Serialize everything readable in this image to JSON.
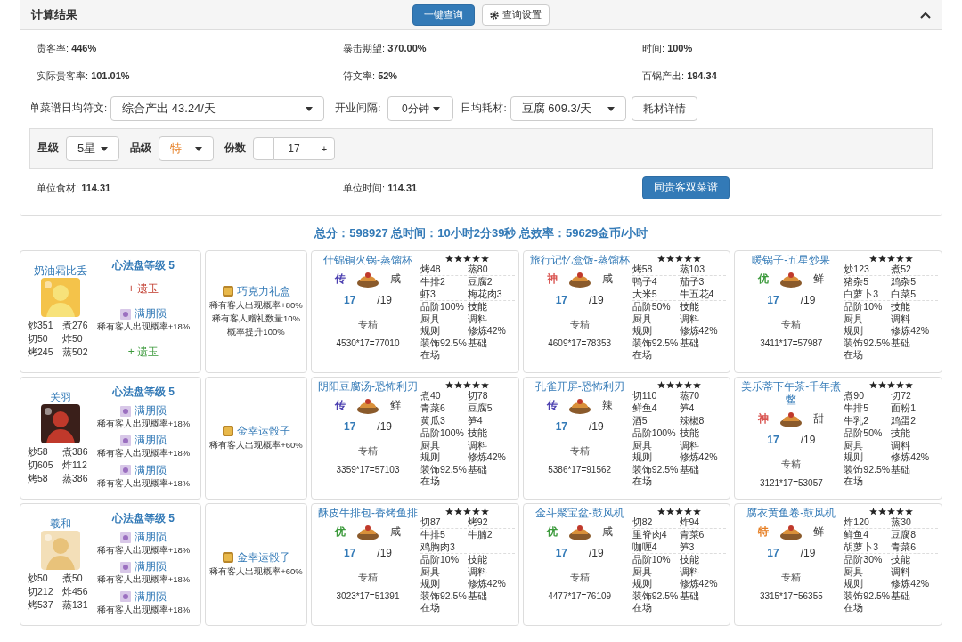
{
  "panel": {
    "title": "计算结果",
    "query_button": "一键查询",
    "settings_button": "查询设置",
    "stats": [
      "贵客率: **446%**",
      "暴击期望: **370.00%**",
      "时间: **100%**",
      "实际贵客率: **101.01%**",
      "符文率: **52%**",
      "百锅产出: **194.34**"
    ],
    "rune": {
      "label": "单菜谱日均符文:",
      "value": "综合产出 43.24/天"
    },
    "interval": {
      "label": "开业间隔:",
      "value": "0分钟"
    },
    "consume": {
      "label": "日均耗材:",
      "value": "豆腐 609.3/天"
    },
    "detail_button": "耗材详情",
    "filter": {
      "star_label": "星级",
      "star_value": "5星",
      "grade_label": "品级",
      "grade_value": "特",
      "count_label": "份数",
      "minus": "-",
      "count": "17",
      "plus": "+"
    },
    "units": [
      "单位食材: **114.31**",
      "单位时间: **114.31**"
    ],
    "dual_button": "同贵客双菜谱"
  },
  "total": "总分：598927 总时间：10小时2分39秒 总效率：59629金币/小时",
  "rows": [
    {
      "chef": {
        "name": "奶油霜比丢",
        "stats": [
          "炒351",
          "煮276",
          "切50",
          "炸50",
          "烤245",
          "蒸502"
        ],
        "panel_title": "心法盘等级 5",
        "items": [
          {
            "kind": "plus",
            "text": "+ 遗玉",
            "color": "#c0392b"
          },
          {
            "kind": "amber",
            "name": "满朋陨",
            "desc": "稀有客人出现概率+18%"
          },
          {
            "kind": "plus",
            "text": "+ 遗玉",
            "color": "#3c9a3c"
          }
        ]
      },
      "equip": {
        "name": "巧克力礼盒",
        "desc": [
          "稀有客人出现概率+80%",
          "稀有客人赠礼数量10%概率提升100%"
        ]
      },
      "recipes": [
        {
          "name": "什锦铜火锅-蒸馏杯",
          "rarity": "传",
          "color": "#4b3fb0",
          "taste": "咸",
          "count": "17",
          "max": "/19",
          "note": "专精",
          "formula": "4530*17=77010",
          "stars": 5,
          "skills": [
            "烤48",
            "蒸80"
          ],
          "ingredients": [
            "牛排2",
            "豆腐2",
            "虾3",
            "梅花肉3"
          ],
          "bonuses": [
            "品阶100%",
            "技能",
            "厨具",
            "调料",
            "规则",
            "修炼42%",
            "装饰92.5%",
            "基础",
            "在场"
          ]
        },
        {
          "name": "旅行记忆盒饭-蒸馏杯",
          "rarity": "神",
          "color": "#d9534f",
          "taste": "咸",
          "count": "17",
          "max": "/19",
          "note": "专精",
          "formula": "4609*17=78353",
          "stars": 5,
          "skills": [
            "烤58",
            "蒸103"
          ],
          "ingredients": [
            "鸭子4",
            "茄子3",
            "大米5",
            "牛五花4"
          ],
          "bonuses": [
            "品阶50%",
            "技能",
            "厨具",
            "调料",
            "规则",
            "修炼42%",
            "装饰92.5%",
            "基础",
            "在场"
          ]
        },
        {
          "name": "暖锅子-五星炒果",
          "rarity": "优",
          "color": "#3c9a3c",
          "taste": "鲜",
          "count": "17",
          "max": "/19",
          "note": "专精",
          "formula": "3411*17=57987",
          "stars": 5,
          "skills": [
            "炒123",
            "煮52"
          ],
          "ingredients": [
            "猪杂5",
            "鸡杂5",
            "白萝卜3",
            "白菜5"
          ],
          "bonuses": [
            "品阶10%",
            "技能",
            "厨具",
            "调料",
            "规则",
            "修炼42%",
            "装饰92.5%",
            "基础",
            "在场"
          ]
        }
      ]
    },
    {
      "chef": {
        "name": "关羽",
        "stats": [
          "炒58",
          "煮386",
          "切605",
          "炸112",
          "烤58",
          "蒸386"
        ],
        "panel_title": "心法盘等级 5",
        "items": [
          {
            "kind": "amber",
            "name": "满朋陨",
            "desc": "稀有客人出现概率+18%"
          },
          {
            "kind": "amber",
            "name": "满朋陨",
            "desc": "稀有客人出现概率+18%"
          },
          {
            "kind": "amber",
            "name": "满朋陨",
            "desc": "稀有客人出现概率+18%"
          }
        ]
      },
      "equip": {
        "name": "金幸运骰子",
        "desc": [
          "稀有客人出现概率+60%"
        ]
      },
      "recipes": [
        {
          "name": "阴阳豆腐汤-恐怖利刃",
          "rarity": "传",
          "color": "#4b3fb0",
          "taste": "鲜",
          "count": "17",
          "max": "/19",
          "note": "专精",
          "formula": "3359*17=57103",
          "stars": 5,
          "skills": [
            "煮40",
            "切78"
          ],
          "ingredients": [
            "青菜6",
            "豆腐5",
            "黄瓜3",
            "笋4"
          ],
          "bonuses": [
            "品阶100%",
            "技能",
            "厨具",
            "调料",
            "规则",
            "修炼42%",
            "装饰92.5%",
            "基础",
            "在场"
          ]
        },
        {
          "name": "孔雀开屏-恐怖利刃",
          "rarity": "传",
          "color": "#4b3fb0",
          "taste": "辣",
          "count": "17",
          "max": "/19",
          "note": "专精",
          "formula": "5386*17=91562",
          "stars": 5,
          "skills": [
            "切110",
            "蒸70"
          ],
          "ingredients": [
            "鲜鱼4",
            "笋4",
            "酒5",
            "辣椒8"
          ],
          "bonuses": [
            "品阶100%",
            "技能",
            "厨具",
            "调料",
            "规则",
            "修炼42%",
            "装饰92.5%",
            "基础",
            "在场"
          ]
        },
        {
          "name": "美乐蒂下午茶-千年煮鳖",
          "rarity": "神",
          "color": "#d9534f",
          "taste": "甜",
          "count": "17",
          "max": "/19",
          "note": "专精",
          "formula": "3121*17=53057",
          "stars": 5,
          "skills": [
            "煮90",
            "切72"
          ],
          "ingredients": [
            "牛排5",
            "面粉1",
            "牛乳2",
            "鸡蛋2"
          ],
          "bonuses": [
            "品阶50%",
            "技能",
            "厨具",
            "调料",
            "规则",
            "修炼42%",
            "装饰92.5%",
            "基础",
            "在场"
          ]
        }
      ]
    },
    {
      "chef": {
        "name": "羲和",
        "stats": [
          "炒50",
          "煮50",
          "切212",
          "炸456",
          "烤537",
          "蒸131"
        ],
        "panel_title": "心法盘等级 5",
        "items": [
          {
            "kind": "amber",
            "name": "满朋陨",
            "desc": "稀有客人出现概率+18%"
          },
          {
            "kind": "amber",
            "name": "满朋陨",
            "desc": "稀有客人出现概率+18%"
          },
          {
            "kind": "amber",
            "name": "满朋陨",
            "desc": "稀有客人出现概率+18%"
          }
        ]
      },
      "equip": {
        "name": "金幸运骰子",
        "desc": [
          "稀有客人出现概率+60%"
        ]
      },
      "recipes": [
        {
          "name": "酥皮牛排包-香烤鱼排",
          "rarity": "优",
          "color": "#3c9a3c",
          "taste": "咸",
          "count": "17",
          "max": "/19",
          "note": "专精",
          "formula": "3023*17=51391",
          "stars": 5,
          "skills": [
            "切87",
            "烤92"
          ],
          "ingredients": [
            "牛排5",
            "牛腩2",
            "鸡胸肉3"
          ],
          "bonuses": [
            "品阶10%",
            "技能",
            "厨具",
            "调料",
            "规则",
            "修炼42%",
            "装饰92.5%",
            "基础",
            "在场"
          ]
        },
        {
          "name": "金斗聚宝盆-鼓风机",
          "rarity": "优",
          "color": "#3c9a3c",
          "taste": "咸",
          "count": "17",
          "max": "/19",
          "note": "专精",
          "formula": "4477*17=76109",
          "stars": 5,
          "skills": [
            "切82",
            "炸94"
          ],
          "ingredients": [
            "里脊肉4",
            "青菜6",
            "咖喱4",
            "笋3"
          ],
          "bonuses": [
            "品阶10%",
            "技能",
            "厨具",
            "调料",
            "规则",
            "修炼42%",
            "装饰92.5%",
            "基础",
            "在场"
          ]
        },
        {
          "name": "腐衣黄鱼卷-鼓风机",
          "rarity": "特",
          "color": "#e67e22",
          "taste": "鲜",
          "count": "17",
          "max": "/19",
          "note": "专精",
          "formula": "3315*17=56355",
          "stars": 5,
          "skills": [
            "炸120",
            "蒸30"
          ],
          "ingredients": [
            "鲜鱼4",
            "豆腐8",
            "胡萝卜3",
            "青菜6"
          ],
          "bonuses": [
            "品阶30%",
            "技能",
            "厨具",
            "调料",
            "规则",
            "修炼42%",
            "装饰92.5%",
            "基础",
            "在场"
          ]
        }
      ]
    }
  ]
}
